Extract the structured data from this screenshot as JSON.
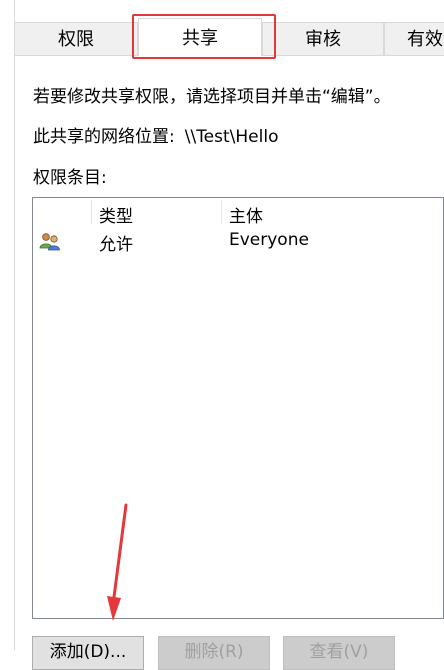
{
  "tabs": [
    {
      "label": "权限"
    },
    {
      "label": "共享"
    },
    {
      "label": "审核"
    },
    {
      "label": "有效"
    }
  ],
  "active_tab": "共享",
  "instruction": "若要修改共享权限，请选择项目并单击“编辑”。",
  "network_location": {
    "label": "此共享的网络位置:",
    "value": "\\\\Test\\Hello"
  },
  "entries_label": "权限条目:",
  "table": {
    "columns": [
      "类型",
      "主体"
    ],
    "rows": [
      {
        "icon": "users-icon",
        "type": "允许",
        "principal": "Everyone"
      }
    ]
  },
  "buttons": {
    "add": "添加(D)...",
    "remove": "删除(R)",
    "view": "查看(V)"
  },
  "colors": {
    "highlight": "#e5383b",
    "arrow": "#e5383b"
  }
}
